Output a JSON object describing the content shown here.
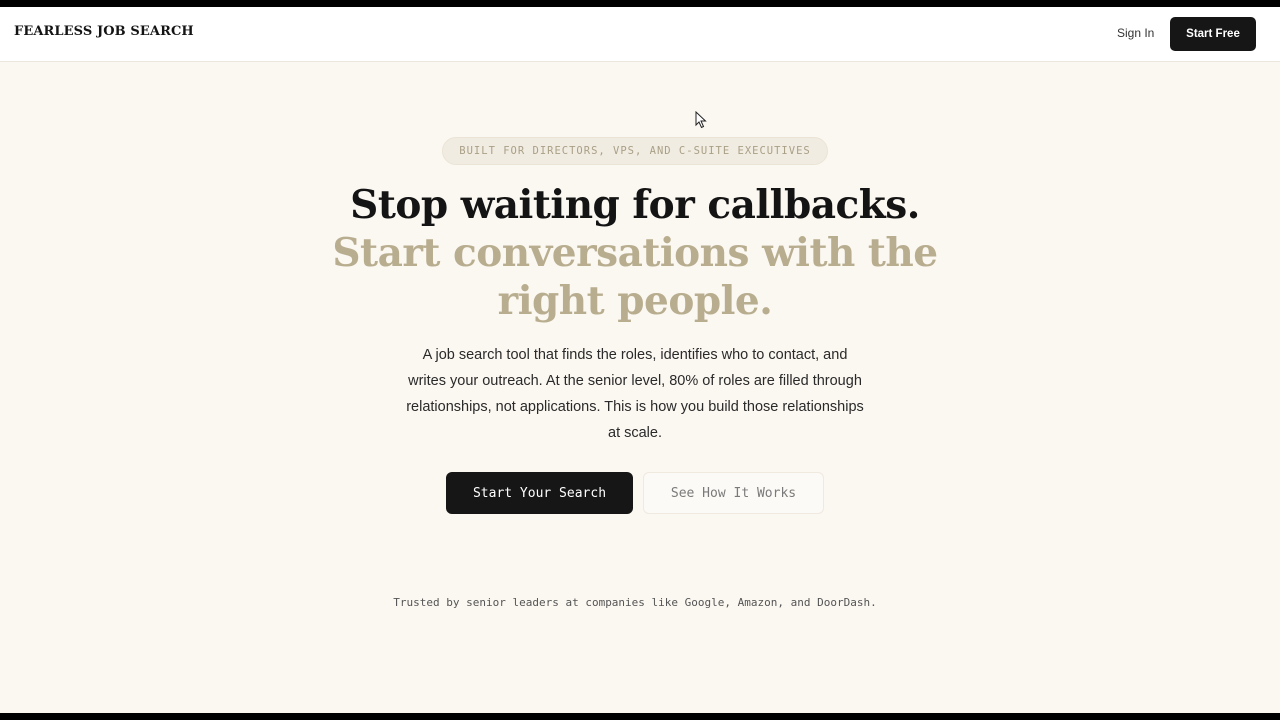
{
  "nav": {
    "logo": "FEARLESS JOB SEARCH",
    "sign_in": "Sign In",
    "start_free": "Start Free"
  },
  "hero": {
    "badge": "BUILT FOR DIRECTORS, VPS, AND C-SUITE EXECUTIVES",
    "headline_line1": "Stop waiting for callbacks.",
    "headline_line2": "Start conversations with the right people.",
    "description": "A job search tool that finds the roles, identifies who to contact, and writes your outreach. At the senior level, 80% of roles are filled through relationships, not applications. This is how you build those relationships at scale.",
    "primary_cta": "Start Your Search",
    "secondary_cta": "See How It Works",
    "trusted_text": "Trusted by senior leaders at companies like Google, Amazon, and DoorDash."
  },
  "colors": {
    "page_background": "#fbf7f1",
    "accent_gold": "#b8ae8f",
    "dark": "#161616"
  },
  "icons": {
    "cursor": "mouse-pointer-icon"
  }
}
